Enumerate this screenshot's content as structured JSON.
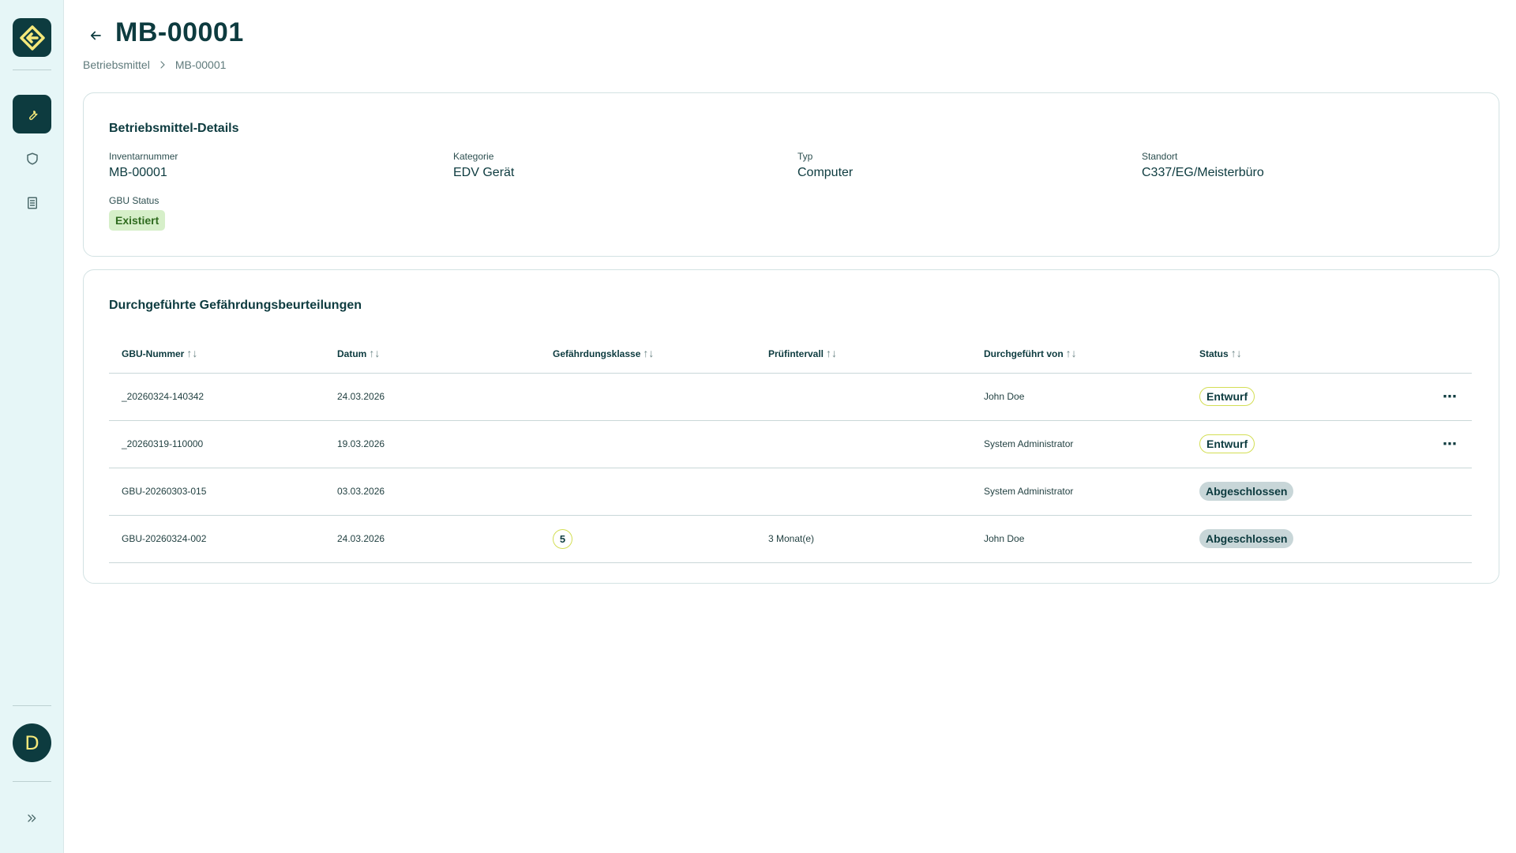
{
  "header": {
    "title": "MB-00001",
    "breadcrumb": [
      "Betriebsmittel",
      "MB-00001"
    ]
  },
  "sidebar": {
    "items": [
      {
        "icon": "wrench-icon",
        "active": true
      },
      {
        "icon": "shield-icon",
        "active": false
      },
      {
        "icon": "document-list-icon",
        "active": false
      }
    ],
    "avatar_initial": "D",
    "expand_icon": "double-chevron-right-icon"
  },
  "details": {
    "title": "Betriebsmittel-Details",
    "fields": [
      {
        "label": "Inventarnummer",
        "value": "MB-00001"
      },
      {
        "label": "Kategorie",
        "value": "EDV Gerät"
      },
      {
        "label": "Typ",
        "value": "Computer"
      },
      {
        "label": "Standort",
        "value": "C337/EG/Meisterbüro"
      }
    ],
    "gbu_status_label": "GBU Status",
    "gbu_status_value": "Existiert"
  },
  "assessments": {
    "title": "Durchgeführte Gefährdungsbeurteilungen",
    "columns": [
      "GBU-Nummer",
      "Datum",
      "Gefährdungsklasse",
      "Prüfintervall",
      "Durchgeführt von",
      "Status"
    ],
    "rows": [
      {
        "number": "_20260324-140342",
        "date": "24.03.2026",
        "class": "",
        "interval": "",
        "by": "John Doe",
        "status": "Entwurf"
      },
      {
        "number": "_20260319-110000",
        "date": "19.03.2026",
        "class": "",
        "interval": "",
        "by": "System Administrator",
        "status": "Entwurf"
      },
      {
        "number": "GBU-20260303-015",
        "date": "03.03.2026",
        "class": "",
        "interval": "",
        "by": "System Administrator",
        "status": "Abgeschlossen"
      },
      {
        "number": "GBU-20260324-002",
        "date": "24.03.2026",
        "class": "5",
        "interval": "3 Monat(e)",
        "by": "John Doe",
        "status": "Abgeschlossen"
      }
    ],
    "sort_glyph": "↑↓",
    "more_glyph": "⋯"
  },
  "colors": {
    "brand_dark": "#0d3b3f",
    "sidebar_bg": "#e6f6f7",
    "accent_yellow": "#f5e87a",
    "exists_bg": "#d6efc9",
    "done_pill_bg": "#c8d6d8",
    "draft_pill_border": "#d3de54"
  }
}
